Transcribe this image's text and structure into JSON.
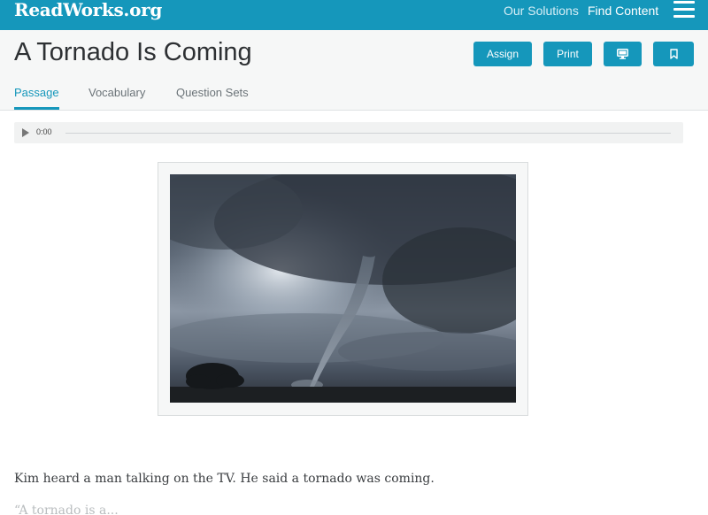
{
  "topbar": {
    "logo": "ReadWorks.org",
    "nav": {
      "solutions": "Our Solutions",
      "find_content": "Find Content"
    },
    "menu_icon": "hamburger-menu-icon"
  },
  "header": {
    "title": "A Tornado Is Coming",
    "buttons": {
      "assign": "Assign",
      "print": "Print"
    },
    "icons": {
      "present": "monitor-icon",
      "bookmark": "bookmark-icon"
    },
    "tabs": [
      "Passage",
      "Vocabulary",
      "Question Sets"
    ],
    "active_tab": "Passage"
  },
  "audio": {
    "time": "0:00",
    "play_icon": "play-icon"
  },
  "passage": {
    "paragraphs": [
      "Kim heard a man talking on the TV. He said a tornado was coming.",
      "“A tornado is a..."
    ]
  },
  "colors": {
    "brand": "#1597bb",
    "header_bg": "#f6f7f7"
  }
}
